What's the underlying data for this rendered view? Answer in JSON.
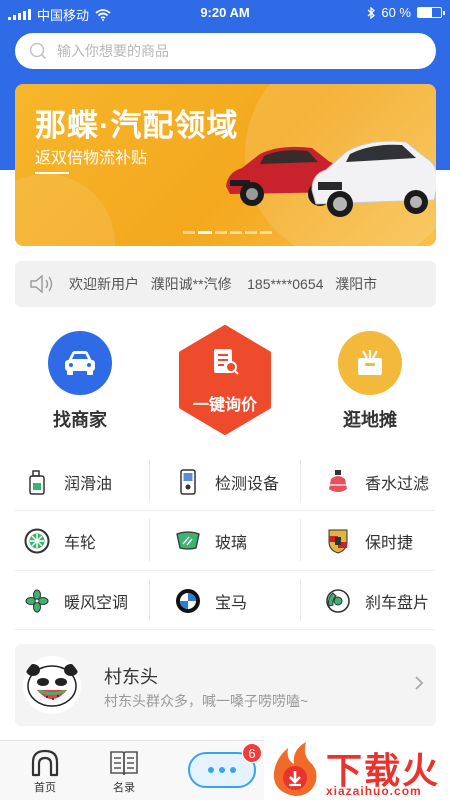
{
  "status_bar": {
    "carrier": "中国移动",
    "time": "9:20 AM",
    "battery": "60 %",
    "battery_level": 0.6
  },
  "search": {
    "placeholder": "输入你想要的商品"
  },
  "banner": {
    "title": "那蝶·汽配领域",
    "subtitle": "返双倍物流补贴"
  },
  "notice": {
    "text": "欢迎新用户   濮阳诚**汽修    185****0654   濮阳市"
  },
  "quick": {
    "find_merchant": "找商家",
    "inquiry": "一键询价",
    "market": "逛地摊"
  },
  "categories": [
    {
      "name": "润滑油",
      "icon": "oil-bottle-icon"
    },
    {
      "name": "检测设备",
      "icon": "diagnostic-device-icon"
    },
    {
      "name": "香水过滤",
      "icon": "perfume-bottle-icon"
    },
    {
      "name": "车轮",
      "icon": "wheel-icon"
    },
    {
      "name": "玻璃",
      "icon": "windshield-icon"
    },
    {
      "name": "保时捷",
      "icon": "porsche-logo-icon"
    },
    {
      "name": "暖风空调",
      "icon": "fan-icon"
    },
    {
      "name": "宝马",
      "icon": "bmw-logo-icon"
    },
    {
      "name": "刹车盘片",
      "icon": "brake-disc-icon"
    }
  ],
  "community": {
    "title": "村东头",
    "desc": "村东头群众多，喊一嗓子唠唠嗑~"
  },
  "tabs": {
    "home": "首页",
    "directory": "名录",
    "badge": "6"
  },
  "watermark": {
    "text": "下载火",
    "url": "xiazaihuo.com"
  },
  "colors": {
    "primary": "#2f6be6",
    "banner": "#f6b62b",
    "inquiry": "#ee4a2c",
    "market": "#f3b93a"
  }
}
